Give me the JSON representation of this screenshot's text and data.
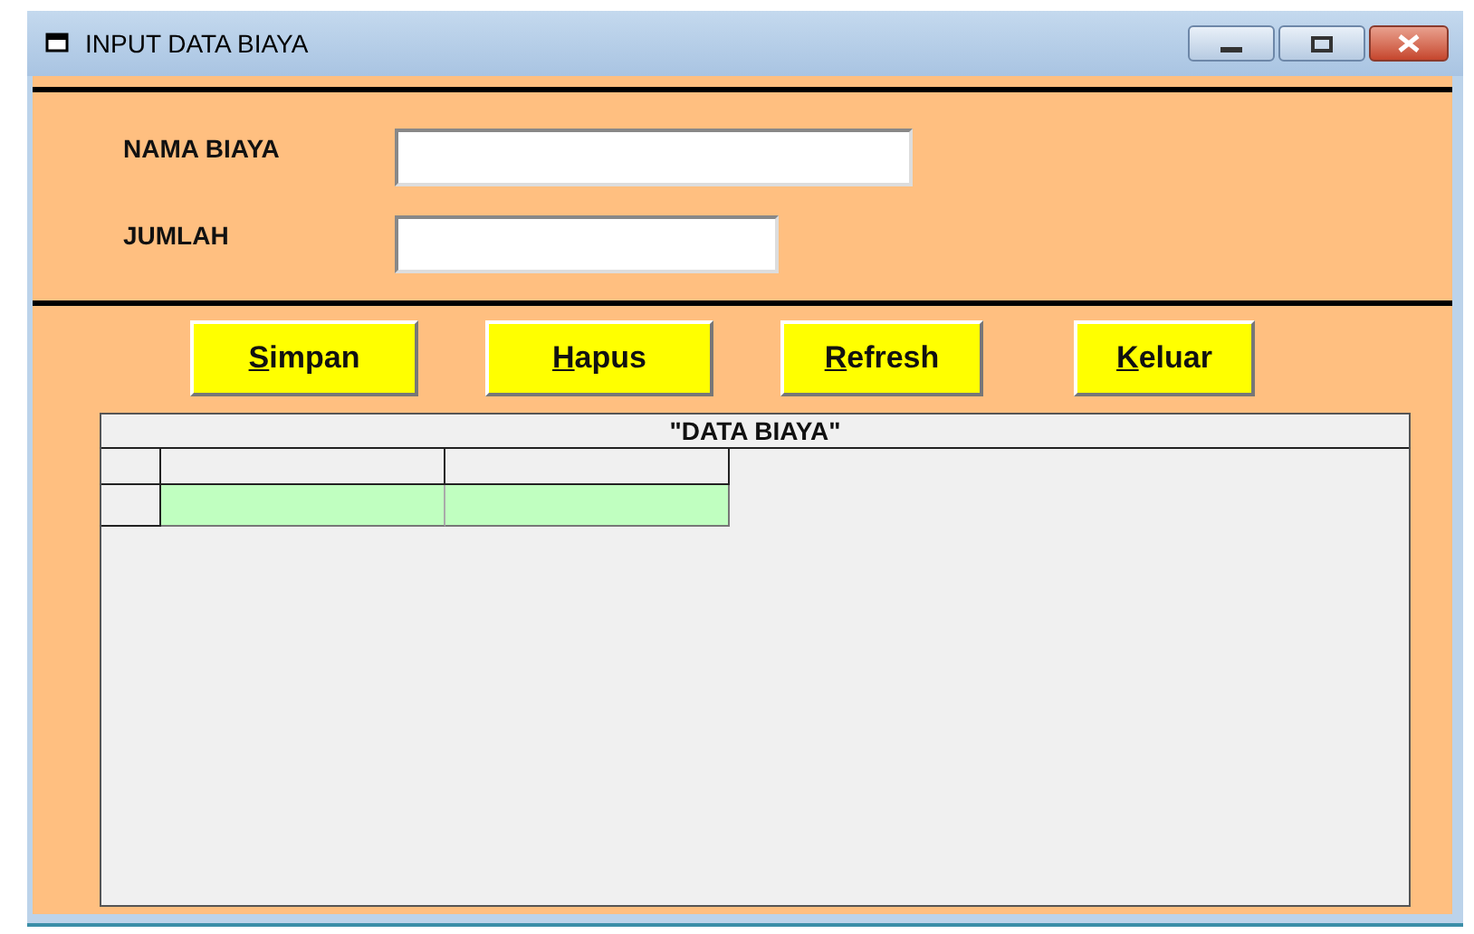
{
  "window": {
    "title": "INPUT DATA BIAYA"
  },
  "fields": [
    {
      "label": "NAMA BIAYA"
    },
    {
      "label": "JUMLAH"
    }
  ],
  "buttons": [
    {
      "label": "Simpan",
      "access_key_underlined": true
    },
    {
      "label": "Hapus",
      "access_key_underlined": true
    },
    {
      "label": "Refresh",
      "access_key_underlined": true
    },
    {
      "label": "Keluar",
      "access_key_underlined": true
    }
  ],
  "grid": {
    "caption": "\"DATA BIAYA\"",
    "rows": [
      {
        "selected": true
      }
    ]
  }
}
